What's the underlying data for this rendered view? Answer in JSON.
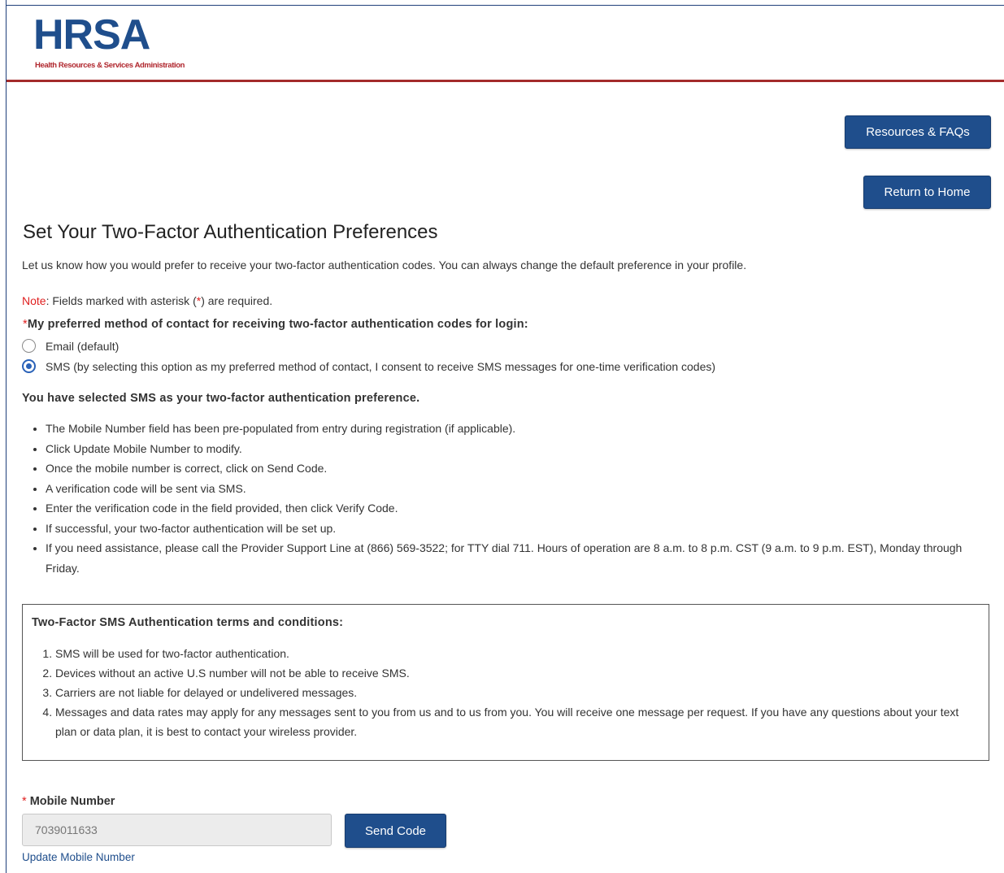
{
  "header": {
    "logo_text": "HRSA",
    "logo_subtitle": "Health Resources & Services Administration"
  },
  "nav": {
    "resources_label": "Resources & FAQs",
    "home_label": "Return to Home"
  },
  "page": {
    "title": "Set Your Two-Factor Authentication Preferences",
    "intro": "Let us know how you would prefer to receive your two-factor authentication codes. You can always change the default preference in your profile.",
    "note_label": "Note",
    "note_text_1": ": Fields marked with asterisk (",
    "note_star": "*",
    "note_text_2": ") are required."
  },
  "preference": {
    "required_mark": "*",
    "question": "My preferred method of contact for receiving two-factor authentication codes for login:",
    "options": [
      {
        "label": "Email (default)",
        "selected": false
      },
      {
        "label": "SMS (by selecting this option as my preferred method of contact, I consent to receive SMS messages for one-time verification codes)",
        "selected": true
      }
    ]
  },
  "selected_heading": "You have selected SMS as your two-factor authentication preference.",
  "steps": [
    "The Mobile Number field has been pre-populated from entry during registration (if applicable).",
    "Click Update Mobile Number to modify.",
    "Once the mobile number is correct, click on Send Code.",
    "A verification code will be sent via SMS.",
    "Enter the verification code in the field provided, then click Verify Code.",
    "If successful, your two-factor authentication will be set up.",
    "If you need assistance, please call the Provider Support Line at (866) 569-3522; for TTY dial 711. Hours of operation are 8 a.m. to 8 p.m. CST (9 a.m. to 9 p.m. EST), Monday through Friday."
  ],
  "terms": {
    "title": "Two-Factor SMS Authentication terms and conditions:",
    "items": [
      "SMS will be used for two-factor authentication.",
      "Devices without an active U.S number will not be able to receive SMS.",
      "Carriers are not liable for delayed or undelivered messages.",
      "Messages and data rates may apply for any messages sent to you from us and to us from you. You will receive one message per request. If you have any questions about your text plan or data plan, it is best to contact your wireless provider."
    ]
  },
  "mobile": {
    "required_mark": "*",
    "label": "Mobile Number",
    "value": "7039011633",
    "send_label": "Send Code",
    "update_label": "Update Mobile Number"
  },
  "colors": {
    "brand_blue": "#1f4e8c",
    "header_rule": "#a32b2b",
    "required_red": "#e02020"
  }
}
